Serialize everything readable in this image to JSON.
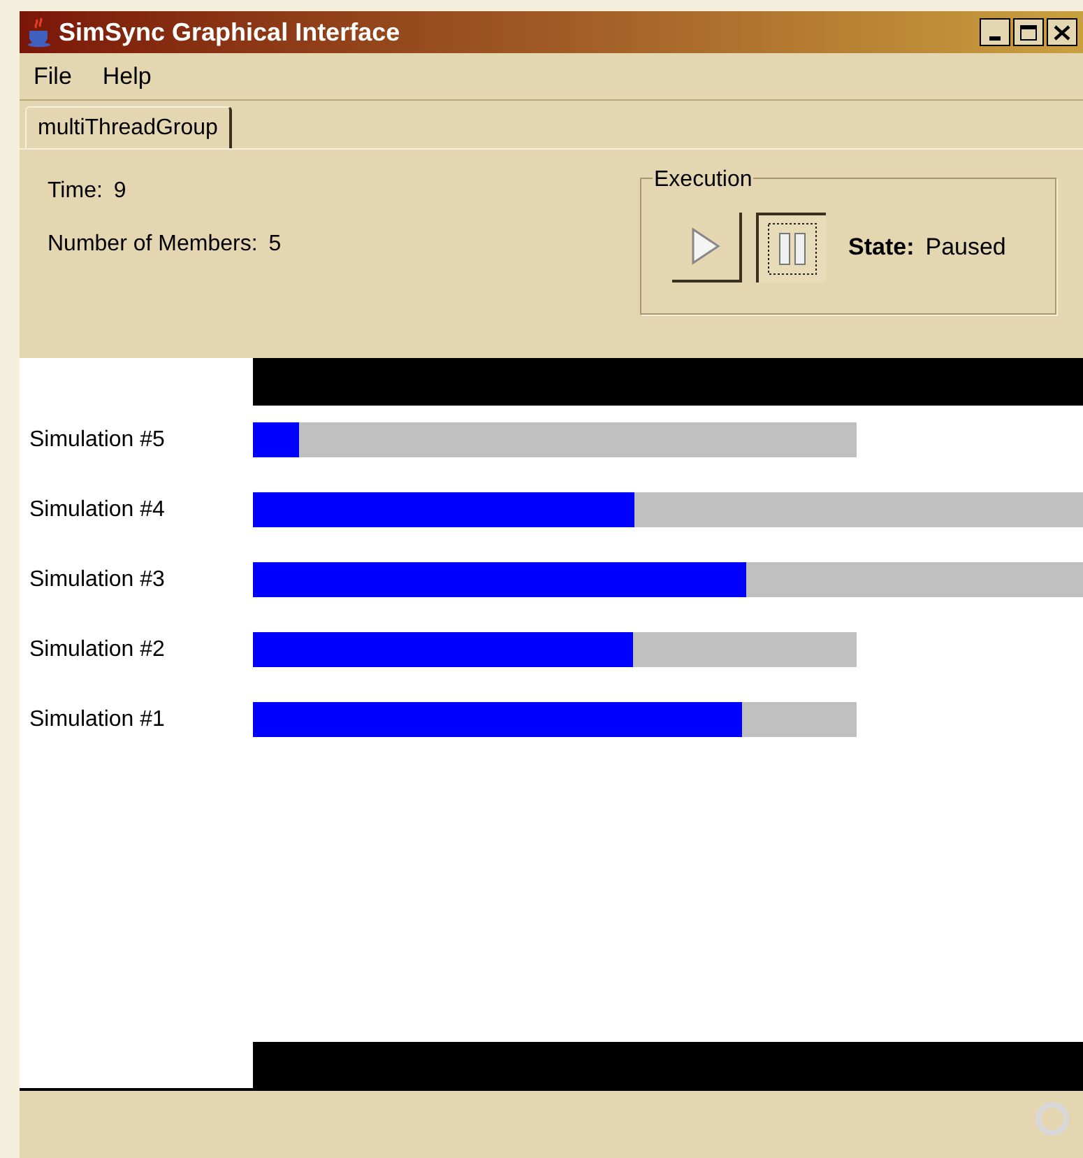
{
  "window": {
    "title": "SimSync Graphical Interface"
  },
  "menu": [
    "File",
    "Help"
  ],
  "tabs": [
    {
      "label": "multiThreadGroup",
      "selected": true
    }
  ],
  "info": {
    "time_label": "Time:",
    "time": "9",
    "members_label": "Number of Members:",
    "members": "5"
  },
  "execution": {
    "title": "Execution",
    "state_label": "State:",
    "state": "Paused",
    "playing": false
  },
  "simulations": [
    {
      "name": "Simulation #5",
      "level": 0.076,
      "kind": "short"
    },
    {
      "name": "Simulation #4",
      "level": 0.46,
      "kind": "long"
    },
    {
      "name": "Simulation #3",
      "level": 0.595,
      "kind": "long"
    },
    {
      "name": "Simulation #2",
      "level": 0.63,
      "kind": "short"
    },
    {
      "name": "Simulation #1",
      "level": 0.81,
      "kind": "short"
    }
  ]
}
